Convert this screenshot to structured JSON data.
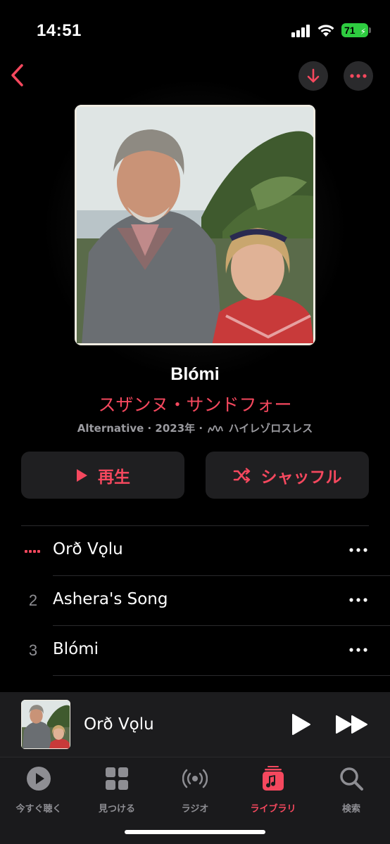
{
  "status_bar": {
    "time": "14:51",
    "battery": "71"
  },
  "album": {
    "title": "Blómi",
    "artist": "スザンヌ・サンドフォー",
    "genre_year": "Alternative · 2023年 · ",
    "format": "ハイレゾロスレス"
  },
  "actions": {
    "play_label": "再生",
    "shuffle_label": "シャッフル"
  },
  "tracks": [
    {
      "number": "",
      "title": "Orð Vǫlu",
      "playing": true
    },
    {
      "number": "2",
      "title": "Ashera's Song",
      "playing": false
    },
    {
      "number": "3",
      "title": "Blómi",
      "playing": false
    }
  ],
  "now_playing": {
    "title": "Orð Vǫlu"
  },
  "tabs": [
    {
      "label": "今すぐ聴く",
      "icon": "play-circle-icon"
    },
    {
      "label": "見つける",
      "icon": "grid-icon"
    },
    {
      "label": "ラジオ",
      "icon": "radio-waves-icon"
    },
    {
      "label": "ライブラリ",
      "icon": "music-library-icon",
      "active": true
    },
    {
      "label": "検索",
      "icon": "search-icon"
    }
  ],
  "colors": {
    "accent": "#f5485e",
    "background": "#000000",
    "surface": "#1f1f21"
  }
}
